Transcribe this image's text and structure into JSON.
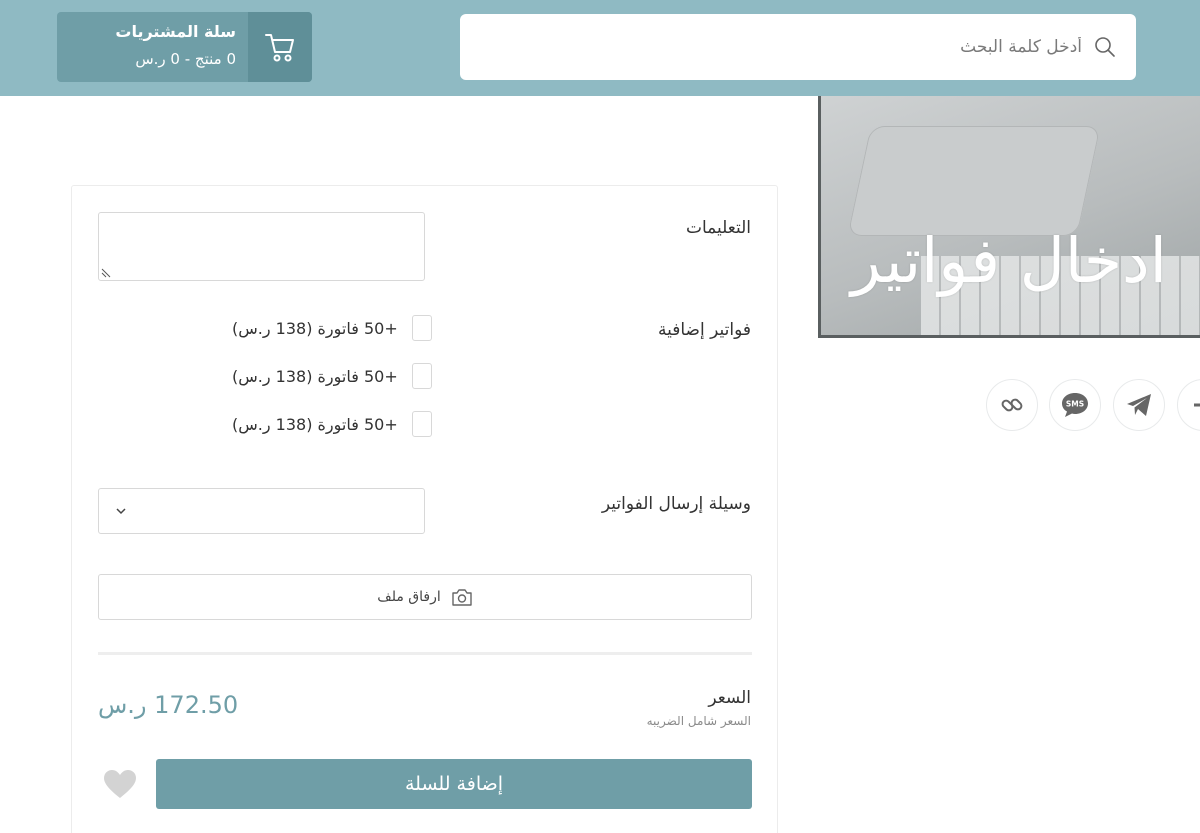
{
  "header": {
    "search": {
      "placeholder": "أدخل كلمة البحث"
    },
    "cart": {
      "title": "سلة المشتريات",
      "summary": "0 منتج - 0 ر.س"
    }
  },
  "product_image": {
    "caption": "ادخال فواتير"
  },
  "share": {
    "icons": [
      "link-icon",
      "sms-icon",
      "telegram-icon",
      "plus-icon"
    ]
  },
  "form": {
    "instructions_label": "التعليمات",
    "extra_invoices_label": "فواتير إضافية",
    "options": [
      {
        "label": "+50 فاتورة (138 ر.س)",
        "checked": false
      },
      {
        "label": "+50 فاتورة (138 ر.س)",
        "checked": false
      },
      {
        "label": "+50 فاتورة (138 ر.س)",
        "checked": false
      }
    ],
    "send_method_label": "وسيلة إرسال الفواتير",
    "send_method_value": "",
    "attach_label": "ارفاق ملف"
  },
  "price": {
    "label": "السعر",
    "note": "السعر شامل الضريبه",
    "value": "172.50 ر.س"
  },
  "actions": {
    "add_to_cart": "إضافة للسلة"
  },
  "colors": {
    "header_bg": "#8fbac3",
    "accent": "#6f9ea7"
  }
}
